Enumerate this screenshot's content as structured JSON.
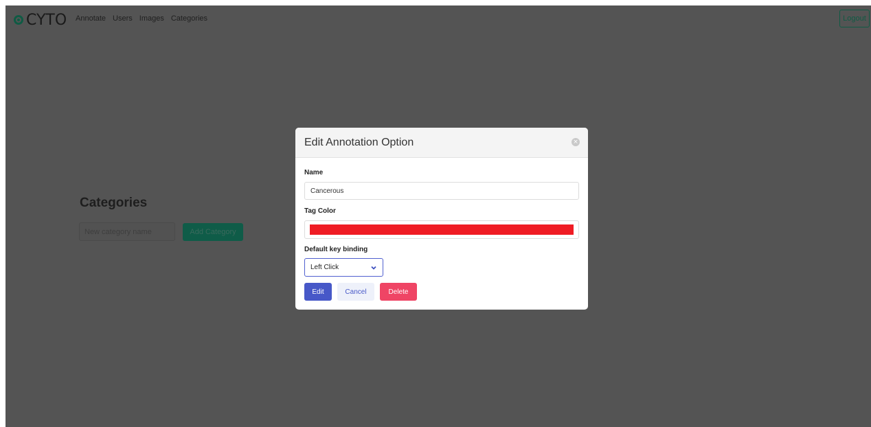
{
  "brand": {
    "name": "CYTO"
  },
  "nav": {
    "links": [
      "Annotate",
      "Users",
      "Images",
      "Categories"
    ],
    "logout_label": "Logout"
  },
  "page": {
    "title": "Categories",
    "new_category_placeholder": "New category name",
    "add_category_label": "Add Category"
  },
  "modal": {
    "title": "Edit Annotation Option",
    "name_label": "Name",
    "name_value": "Cancerous",
    "tag_color_label": "Tag Color",
    "tag_color": "#ef1c24",
    "key_binding_label": "Default key binding",
    "key_binding_value": "Left Click",
    "edit_label": "Edit",
    "cancel_label": "Cancel",
    "delete_label": "Delete"
  },
  "colors": {
    "backdrop": "#545454",
    "brand_green": "#0f5b44",
    "primary": "#4758c8",
    "danger": "#ef4565"
  }
}
